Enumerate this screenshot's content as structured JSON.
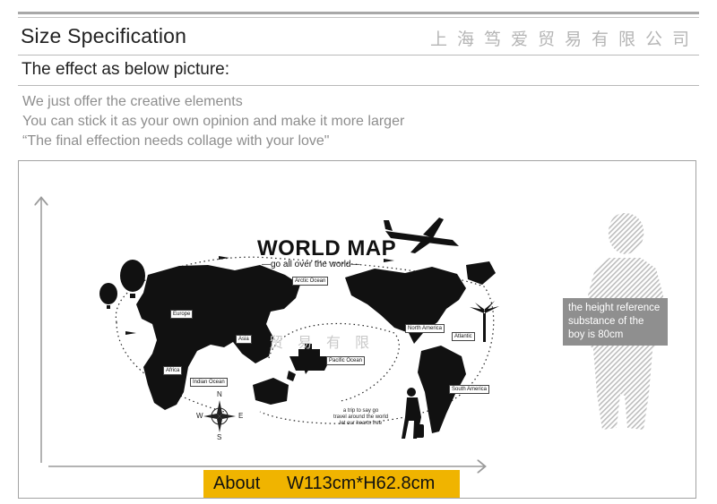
{
  "header": {
    "title": "Size Specification",
    "company": "上海笃爱贸易有限公司",
    "subtitle": "The effect as below picture:"
  },
  "notes": [
    "We just offer the creative elements",
    "You can stick it as your own opinion and make it more larger",
    "“The final effection needs collage with your love\""
  ],
  "map": {
    "title": "WORLD MAP",
    "subtitle": "—go all over the world—",
    "labels": {
      "arctic": "Arctic Ocean",
      "europe": "Europe",
      "asia": "Asia",
      "africa": "Africa",
      "indian": "Indian Ocean",
      "pacific": "Pacific Ocean",
      "north_america": "North America",
      "atlantic": "Atlantic",
      "south_america": "South America"
    },
    "trip_lines": [
      "a trip to say go",
      "travel around the world",
      "let our hearts free"
    ],
    "compass": {
      "n": "N",
      "s": "S",
      "e": "E",
      "w": "W"
    },
    "watermark": "贸易有限"
  },
  "reference": {
    "lines": [
      "the height reference",
      "substance of the",
      "boy is 80cm"
    ]
  },
  "size": {
    "label": "About",
    "value": "W113cm*H62.8cm",
    "accent": "#f0b400"
  }
}
